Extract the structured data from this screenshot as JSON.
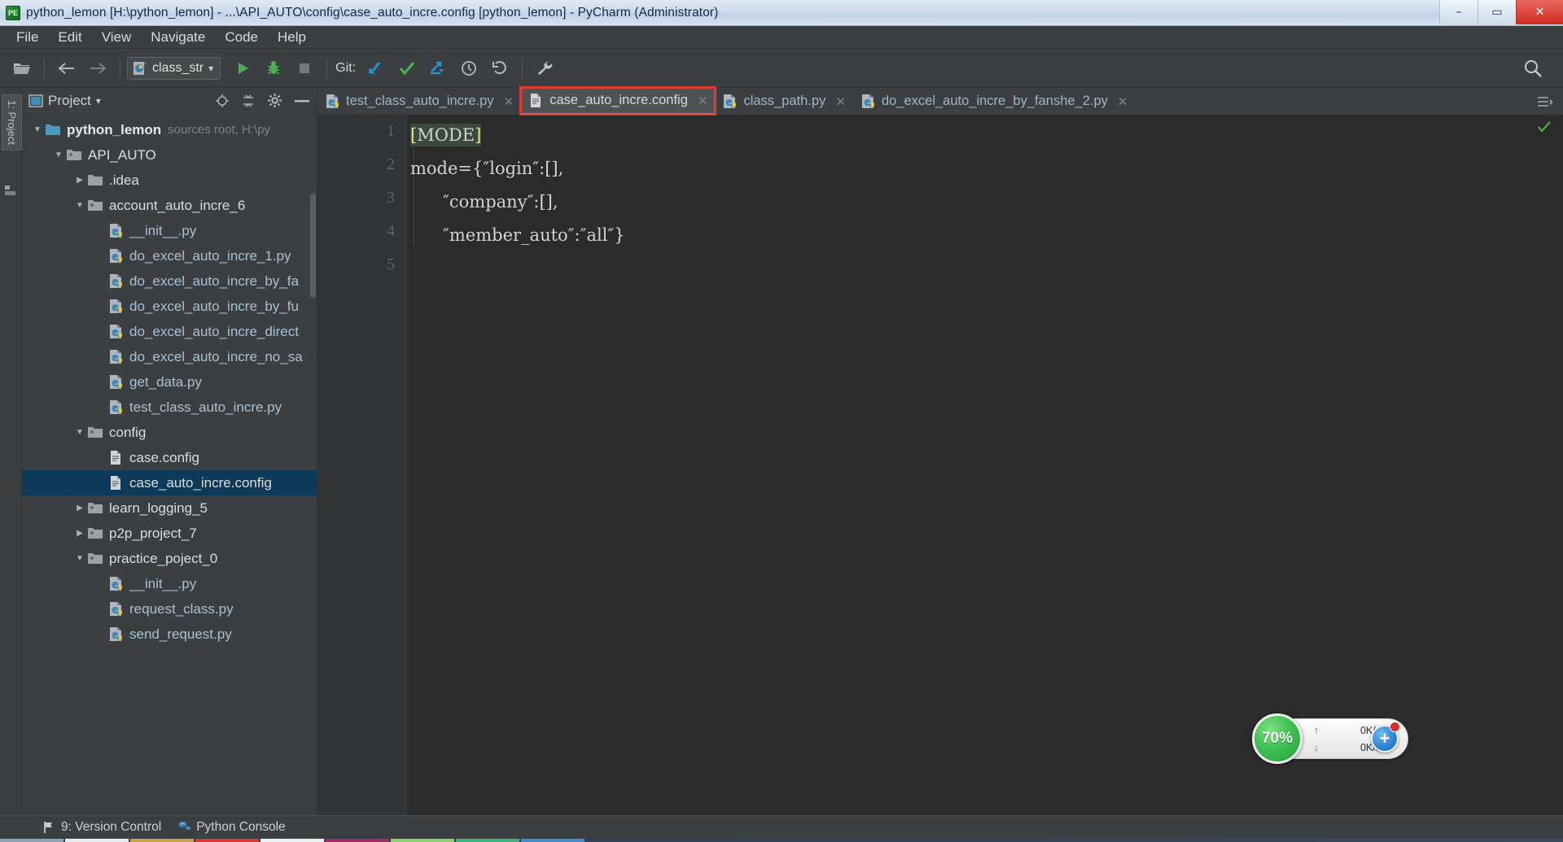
{
  "window": {
    "title": "python_lemon [H:\\python_lemon] - ...\\API_AUTO\\config\\case_auto_incre.config [python_lemon] - PyCharm (Administrator)",
    "app_icon": "pycharm-icon",
    "minimize": "–",
    "maximize": "▭",
    "close": "✕"
  },
  "menubar": {
    "items": [
      {
        "label": "File",
        "name": "menu-file"
      },
      {
        "label": "Edit",
        "name": "menu-edit"
      },
      {
        "label": "View",
        "name": "menu-view"
      },
      {
        "label": "Navigate",
        "name": "menu-navigate"
      },
      {
        "label": "Code",
        "name": "menu-code"
      },
      {
        "label": "Help",
        "name": "menu-help"
      }
    ]
  },
  "toolbar": {
    "open_icon": "open-folder-icon",
    "back_icon": "back-arrow-icon",
    "forward_icon": "forward-arrow-icon",
    "run_config": {
      "label": "class_str",
      "icon": "python-file-icon",
      "chevron": "▾"
    },
    "run_icon": "run-play-icon",
    "debug_icon": "debug-bug-icon",
    "stop_icon": "stop-square-icon",
    "git_label": "Git:",
    "git_update_icon": "git-update-icon",
    "git_commit_icon": "git-commit-check-icon",
    "git_push_icon": "git-push-icon",
    "history_icon": "history-clock-icon",
    "revert_icon": "undo-revert-icon",
    "settings_icon": "wrench-icon",
    "search_icon": "search-magnifier-icon"
  },
  "left_strip": {
    "project_tab": "1: Project",
    "structure_icon": "structure-icon"
  },
  "project_panel": {
    "title": "Project",
    "chevron": "▾",
    "target_icon": "locate-target-icon",
    "collapse_icon": "collapse-all-icon",
    "gear_icon": "gear-icon",
    "hide_icon": "hide-panel-icon",
    "tree": [
      {
        "label": "python_lemon",
        "sub": "sources root, H:\\py",
        "indent": 0,
        "arrow": "▼",
        "icon": "folder-blue-icon",
        "style": "bold",
        "selected": false
      },
      {
        "label": "API_AUTO",
        "sub": "",
        "indent": 1,
        "arrow": "▼",
        "icon": "folder-source-icon",
        "style": "plain",
        "selected": false
      },
      {
        "label": ".idea",
        "sub": "",
        "indent": 2,
        "arrow": "▶",
        "icon": "folder-gray-icon",
        "style": "plain",
        "selected": false
      },
      {
        "label": "account_auto_incre_6",
        "sub": "",
        "indent": 2,
        "arrow": "▼",
        "icon": "folder-source-icon",
        "style": "plain",
        "selected": false
      },
      {
        "label": "__init__.py",
        "sub": "",
        "indent": 3,
        "arrow": "",
        "icon": "python-file-icon",
        "style": "py",
        "selected": false
      },
      {
        "label": "do_excel_auto_incre_1.py",
        "sub": "",
        "indent": 3,
        "arrow": "",
        "icon": "python-file-icon",
        "style": "py",
        "selected": false
      },
      {
        "label": "do_excel_auto_incre_by_fa",
        "sub": "",
        "indent": 3,
        "arrow": "",
        "icon": "python-file-icon",
        "style": "py",
        "selected": false
      },
      {
        "label": "do_excel_auto_incre_by_fu",
        "sub": "",
        "indent": 3,
        "arrow": "",
        "icon": "python-file-icon",
        "style": "py",
        "selected": false
      },
      {
        "label": "do_excel_auto_incre_direct",
        "sub": "",
        "indent": 3,
        "arrow": "",
        "icon": "python-file-icon",
        "style": "py",
        "selected": false
      },
      {
        "label": "do_excel_auto_incre_no_sa",
        "sub": "",
        "indent": 3,
        "arrow": "",
        "icon": "python-file-icon",
        "style": "py",
        "selected": false
      },
      {
        "label": "get_data.py",
        "sub": "",
        "indent": 3,
        "arrow": "",
        "icon": "python-file-icon",
        "style": "py",
        "selected": false
      },
      {
        "label": "test_class_auto_incre.py",
        "sub": "",
        "indent": 3,
        "arrow": "",
        "icon": "python-file-icon",
        "style": "py",
        "selected": false
      },
      {
        "label": "config",
        "sub": "",
        "indent": 2,
        "arrow": "▼",
        "icon": "folder-source-icon",
        "style": "plain",
        "selected": false
      },
      {
        "label": "case.config",
        "sub": "",
        "indent": 3,
        "arrow": "",
        "icon": "config-file-icon",
        "style": "plain",
        "selected": false
      },
      {
        "label": "case_auto_incre.config",
        "sub": "",
        "indent": 3,
        "arrow": "",
        "icon": "config-file-icon",
        "style": "plain",
        "selected": true
      },
      {
        "label": "learn_logging_5",
        "sub": "",
        "indent": 2,
        "arrow": "▶",
        "icon": "folder-source-icon",
        "style": "plain",
        "selected": false
      },
      {
        "label": "p2p_project_7",
        "sub": "",
        "indent": 2,
        "arrow": "▶",
        "icon": "folder-source-icon",
        "style": "plain",
        "selected": false
      },
      {
        "label": "practice_poject_0",
        "sub": "",
        "indent": 2,
        "arrow": "▼",
        "icon": "folder-source-icon",
        "style": "plain",
        "selected": false
      },
      {
        "label": "__init__.py",
        "sub": "",
        "indent": 3,
        "arrow": "",
        "icon": "python-file-icon",
        "style": "py",
        "selected": false
      },
      {
        "label": "request_class.py",
        "sub": "",
        "indent": 3,
        "arrow": "",
        "icon": "python-file-icon",
        "style": "py",
        "selected": false
      },
      {
        "label": "send_request.py",
        "sub": "",
        "indent": 3,
        "arrow": "",
        "icon": "python-file-icon",
        "style": "py",
        "selected": false
      }
    ]
  },
  "editor_tabs": {
    "items": [
      {
        "label": "test_class_auto_incre.py",
        "icon": "python-file-icon",
        "close": "✕",
        "active": false,
        "highlighted": false
      },
      {
        "label": "case_auto_incre.config",
        "icon": "config-file-icon",
        "close": "✕",
        "active": true,
        "highlighted": true
      },
      {
        "label": "class_path.py",
        "icon": "python-file-icon",
        "close": "✕",
        "active": false,
        "highlighted": false
      },
      {
        "label": "do_excel_auto_incre_by_fanshe_2.py",
        "icon": "python-file-icon",
        "close": "✕",
        "active": false,
        "highlighted": false
      }
    ],
    "overflow_icon": "tab-list-icon",
    "inspection_ok_icon": "inspection-ok-icon"
  },
  "editor": {
    "line_numbers": [
      "1",
      "2",
      "3",
      "4",
      "5"
    ],
    "lines": [
      {
        "open_bracket": "[",
        "text": "MODE",
        "close_bracket": "]"
      },
      {
        "text": "mode={″login″:[],"
      },
      {
        "text": "      ″company″:[],"
      },
      {
        "text": "      ″member_auto″:″all″}"
      },
      {
        "text": ""
      }
    ]
  },
  "net_widget": {
    "percent": "70%",
    "upload_rate": "0K/s",
    "download_rate": "0K/s",
    "upload_arrow": "↑",
    "download_arrow": "↓",
    "plus_label": "+",
    "badge_icon": "notification-badge-icon"
  },
  "statusbar": {
    "items": [
      {
        "label": "9: Version Control",
        "shortcut": "9",
        "icon": "version-control-icon",
        "name": "statusbar-version-control"
      },
      {
        "label": "Python Console",
        "shortcut": "",
        "icon": "python-console-icon",
        "name": "statusbar-python-console"
      }
    ]
  },
  "colors": {
    "accent_red": "#e03b2f",
    "tab_underline": "#49b0c4",
    "selection_blue": "#0d3a58",
    "editor_bg": "#2b2b2b",
    "panel_bg": "#3c3f41"
  }
}
